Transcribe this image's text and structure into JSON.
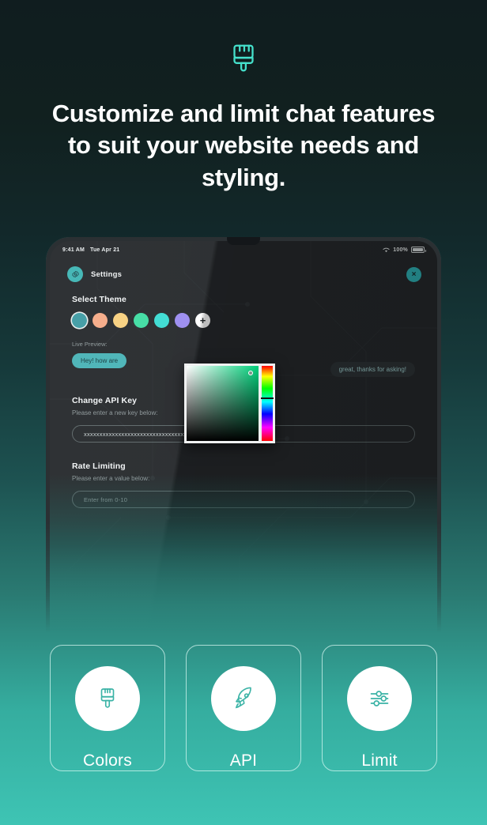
{
  "hero": {
    "icon": "paint-brush-icon",
    "title": "Customize and limit chat features to suit your website needs and styling."
  },
  "tablet": {
    "status_bar": {
      "time": "9:41 AM",
      "date": "Tue Apr 21",
      "wifi_icon": "wifi-icon",
      "battery_percent": "100%",
      "battery_icon": "battery-full-icon"
    },
    "app_header": {
      "gear_icon": "gear-icon",
      "title": "Settings",
      "close_icon": "close-icon",
      "close_label": "×"
    },
    "theme_section": {
      "title": "Select Theme",
      "swatches": [
        {
          "name": "theme-teal",
          "color": "#3f9ba3",
          "selected": true
        },
        {
          "name": "theme-peach",
          "color": "#f6ab87",
          "selected": false
        },
        {
          "name": "theme-yellow",
          "color": "#f8d07f",
          "selected": false
        },
        {
          "name": "theme-green",
          "color": "#3fdda2",
          "selected": false
        },
        {
          "name": "theme-cyan",
          "color": "#3bdcd2",
          "selected": false
        },
        {
          "name": "theme-purple",
          "color": "#9b8cf0",
          "selected": false
        }
      ],
      "add_label": "+",
      "live_preview_label": "Live Preview:",
      "messages": [
        {
          "from": "in",
          "text": "Hey! how are"
        },
        {
          "from": "out",
          "text": "great, thanks for asking!"
        }
      ]
    },
    "color_picker": {
      "name": "color-picker-popup",
      "hue_handle_position": "42%",
      "selected_swatch_color": "#00d07a"
    },
    "api_section": {
      "title": "Change API Key",
      "subtitle": "Please enter a new key below:",
      "value": "xxxxxxxxxxxxxxxxxxxxxxxxxxxxxxxxxxxxxxxxxxxx"
    },
    "rate_section": {
      "title": "Rate Limiting",
      "subtitle": "Please enter a value below:",
      "placeholder": "Enter from 0-10",
      "value": ""
    }
  },
  "features": [
    {
      "icon": "paint-brush-icon",
      "label": "Colors"
    },
    {
      "icon": "rocket-icon",
      "label": "API"
    },
    {
      "icon": "sliders-icon",
      "label": "Limit"
    }
  ],
  "colors": {
    "accent_teal": "#3ec4b4",
    "hero_icon": "#45e0cb",
    "background_top": "#101d1f",
    "background_bottom": "#3ec4b4",
    "card_icon_stroke": "#3bb3a6"
  }
}
